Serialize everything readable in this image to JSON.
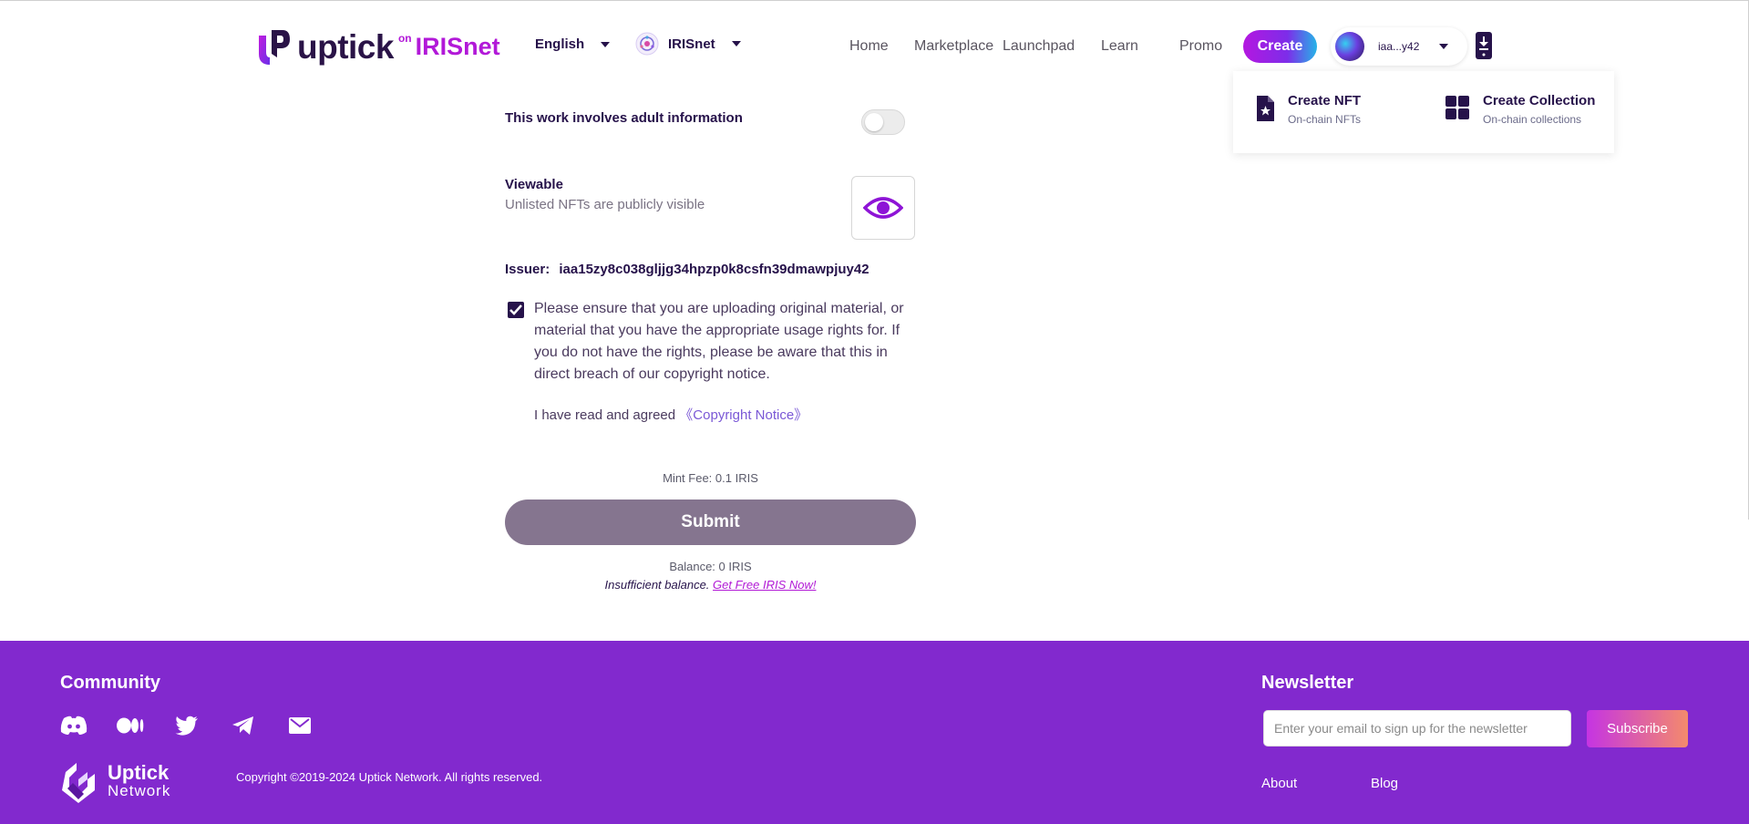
{
  "header": {
    "logo_word": "uptick",
    "logo_on": "on",
    "logo_net": "IRISnet",
    "language": "English",
    "network": "IRISnet",
    "nav": [
      "Home",
      "Marketplace",
      "Launchpad",
      "Learn",
      "Promo"
    ],
    "create_label": "Create",
    "account_address": "iaa...y42"
  },
  "dropdown": {
    "create_nft_title": "Create NFT",
    "create_nft_sub": "On-chain NFTs",
    "create_collection_title": "Create Collection",
    "create_collection_sub": "On-chain collections"
  },
  "form": {
    "adult_label": "This work involves adult information",
    "adult_enabled": false,
    "viewable_label": "Viewable",
    "viewable_sub": "Unlisted NFTs are publicly visible",
    "issuer_label": "Issuer:",
    "issuer_value": "iaa15zy8c038gljjg34hpzp0k8csfn39dmawpjuy42",
    "rights_checked": true,
    "rights_notice": "Please ensure that you are uploading original material, or material that you have the appropriate usage rights for. If you do not have the rights, please be aware that this in direct breach of our copyright notice.",
    "agree_text": "I have read and agreed",
    "copyright_link": "《Copyright Notice》",
    "mint_fee": "Mint Fee: 0.1 IRIS",
    "submit_label": "Submit",
    "balance": "Balance: 0 IRIS",
    "insufficient": "Insufficient balance.",
    "get_free_link": "Get Free IRIS Now!"
  },
  "footer": {
    "community_title": "Community",
    "social_icons": [
      "discord-icon",
      "medium-icon",
      "twitter-icon",
      "telegram-icon",
      "mail-icon"
    ],
    "logo_line1": "Uptick",
    "logo_line2": "Network",
    "copyright": "Copyright ©2019-2024 Uptick Network. All rights reserved.",
    "newsletter_title": "Newsletter",
    "email_placeholder": "Enter your email to sign up for the newsletter",
    "subscribe_label": "Subscribe",
    "links": [
      "About",
      "Blog"
    ]
  },
  "colors": {
    "brand_purple": "#8229ce",
    "text_dark": "#26124a",
    "accent_magenta": "#b219d8",
    "submit_disabled": "#85758f"
  }
}
